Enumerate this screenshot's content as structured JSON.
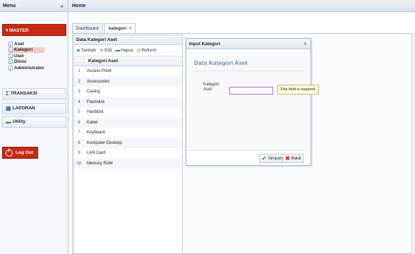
{
  "sidebar": {
    "header": "Menu",
    "collapse_icon": "double-chevron-left-icon",
    "master_label": "MASTER",
    "items": [
      {
        "label": "Aset",
        "active": false
      },
      {
        "label": "Kategori",
        "active": true
      },
      {
        "label": "User",
        "active": false
      },
      {
        "label": "Divisi",
        "active": false
      },
      {
        "label": "Administrator",
        "active": false
      }
    ],
    "panels": [
      {
        "label": "TRANSAKSI",
        "icon": "sigma-icon"
      },
      {
        "label": "LAPORAN",
        "icon": "report-icon"
      },
      {
        "label": "Utility",
        "icon": "utility-icon"
      }
    ],
    "logout_label": "Log Out",
    "colors": {
      "accent": "#c62a15",
      "active_item_bg": "#f7c9c4"
    }
  },
  "main": {
    "header": "Home",
    "tabs": [
      {
        "label": "Dashboard",
        "active": false
      },
      {
        "label": "kategori",
        "active": true,
        "closable": true
      }
    ]
  },
  "grid": {
    "title": "Data Kategori Aset",
    "toolbar": [
      {
        "label": "Tambah",
        "icon": "add-icon"
      },
      {
        "label": "Edit",
        "icon": "edit-icon"
      },
      {
        "label": "Hapus",
        "icon": "delete-icon"
      },
      {
        "label": "Refresh",
        "icon": "refresh-icon"
      }
    ],
    "column": "Kategori Aset",
    "rows": [
      {
        "n": "1",
        "v": "Access Point"
      },
      {
        "n": "2",
        "v": "Accessories"
      },
      {
        "n": "3",
        "v": "Casing"
      },
      {
        "n": "4",
        "v": "Flashdisk"
      },
      {
        "n": "5",
        "v": "Harddisk"
      },
      {
        "n": "6",
        "v": "Kabel"
      },
      {
        "n": "7",
        "v": "Keyboard"
      },
      {
        "n": "8",
        "v": "Komputer Desktop"
      },
      {
        "n": "9",
        "v": "LAN Card"
      },
      {
        "n": "10",
        "v": "Memory RAM"
      }
    ]
  },
  "dialog": {
    "title": "Input Kategori",
    "close": "x",
    "heading": "Data Kategori Aset",
    "field_label": "Kategori Aset:",
    "field_value": "",
    "tooltip": "This field is required.",
    "save_label": "Simpan",
    "cancel_label": "Batal"
  }
}
